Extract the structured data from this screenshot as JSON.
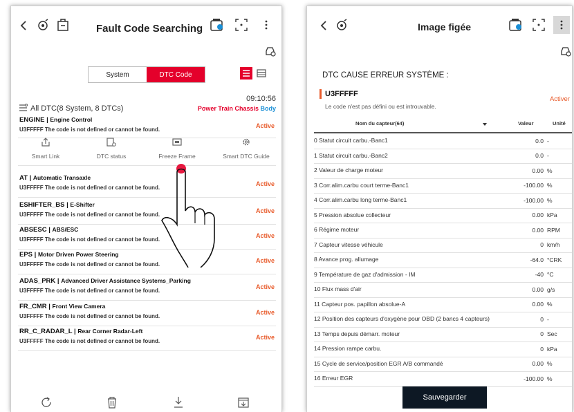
{
  "left_screen": {
    "title": "Fault Code Searching",
    "tabs": {
      "system": "System",
      "dtc_code": "DTC Code"
    },
    "summary": "All DTC(8 System, 8 DTCs)",
    "time": "09:10:56",
    "filters": {
      "power_train": "Power Train",
      "chassis": "Chassis",
      "body": "Body"
    },
    "rows": [
      {
        "name": "ENGINE",
        "sub": "Engine Control",
        "desc": "U3FFFFF The code is not defined or cannot be found.",
        "status": "Active"
      },
      {
        "name": "AT",
        "sub": "Automatic Transaxle",
        "desc": "U3FFFFF The code is not defined or cannot be found.",
        "status": "Active"
      },
      {
        "name": "ESHIFTER_BS",
        "sub": "E-Shifter",
        "desc": "U3FFFFF The code is not defined or cannot be found.",
        "status": "Active"
      },
      {
        "name": "ABSESC",
        "sub": "ABS/ESC",
        "desc": "U3FFFFF The code is not defined or cannot be found.",
        "status": "Active"
      },
      {
        "name": "EPS",
        "sub": "Motor Driven Power Steering",
        "desc": "U3FFFFF The code is not defined or cannot be found.",
        "status": "Active"
      },
      {
        "name": "ADAS_PRK",
        "sub": "Advanced Driver Assistance Systems_Parking",
        "desc": "U3FFFFF The code is not defined or cannot be found.",
        "status": "Active"
      },
      {
        "name": "FR_CMR",
        "sub": "Front View Camera",
        "desc": "U3FFFFF The code is not defined or cannot be found.",
        "status": "Active"
      },
      {
        "name": "RR_C_RADAR_L",
        "sub": "Rear Corner Radar-Left",
        "desc": "U3FFFFF The code is not defined or cannot be found.",
        "status": "Active"
      }
    ],
    "actions": {
      "smart_link": "Smart Link",
      "dtc_status": "DTC status",
      "freeze_frame": "Freeze Frame",
      "smart_dtc_guide": "Smart DTC Guide"
    }
  },
  "right_screen": {
    "title": "Image figée",
    "section": "DTC CAUSE ERREUR SYSTÈME :",
    "code": "U3FFFFF",
    "code_desc": "Le code n'est pas défini ou est introuvable.",
    "status": "Activer",
    "headers": {
      "name": "Nom du capteur(64)",
      "value": "Valeur",
      "unit": "Unité"
    },
    "rows": [
      {
        "name": "0 Statut circuit carbu.-Banc1",
        "value": "0.0",
        "unit": "-"
      },
      {
        "name": "1 Statut circuit carbu.-Banc2",
        "value": "0.0",
        "unit": "-"
      },
      {
        "name": "2 Valeur de charge moteur",
        "value": "0.00",
        "unit": "%"
      },
      {
        "name": "3 Corr.alim.carbu court terme-Banc1",
        "value": "-100.00",
        "unit": "%"
      },
      {
        "name": "4 Corr.alim.carbu long terme-Banc1",
        "value": "-100.00",
        "unit": "%"
      },
      {
        "name": "5 Pression absolue collecteur",
        "value": "0.00",
        "unit": "kPa"
      },
      {
        "name": "6 Régime moteur",
        "value": "0.00",
        "unit": "RPM"
      },
      {
        "name": "7 Capteur vitesse véhicule",
        "value": "0",
        "unit": "km/h"
      },
      {
        "name": "8 Avance prog. allumage",
        "value": "-64.0",
        "unit": "°CRK"
      },
      {
        "name": "9 Température de gaz d'admission - IM",
        "value": "-40",
        "unit": "°C"
      },
      {
        "name": "10 Flux mass d'air",
        "value": "0.00",
        "unit": "g/s"
      },
      {
        "name": "11 Capteur pos. papillon absolue-A",
        "value": "0.00",
        "unit": "%"
      },
      {
        "name": "12 Position des capteurs d'oxygène pour OBD (2 bancs 4 capteurs)",
        "value": "0",
        "unit": "-"
      },
      {
        "name": "13 Temps depuis démarr. moteur",
        "value": "0",
        "unit": "Sec"
      },
      {
        "name": "14 Pression rampe carbu.",
        "value": "0",
        "unit": "kPa"
      },
      {
        "name": "15 Cycle de service/position EGR A/B commandé",
        "value": "0.00",
        "unit": "%"
      },
      {
        "name": "16 Erreur EGR",
        "value": "-100.00",
        "unit": "%"
      }
    ],
    "save_label": "Sauvegarder"
  },
  "colors": {
    "accent_red": "#e4002b",
    "active_orange": "#e85a2a",
    "body_blue": "#1a8fd6",
    "dark_button": "#0d1824"
  }
}
